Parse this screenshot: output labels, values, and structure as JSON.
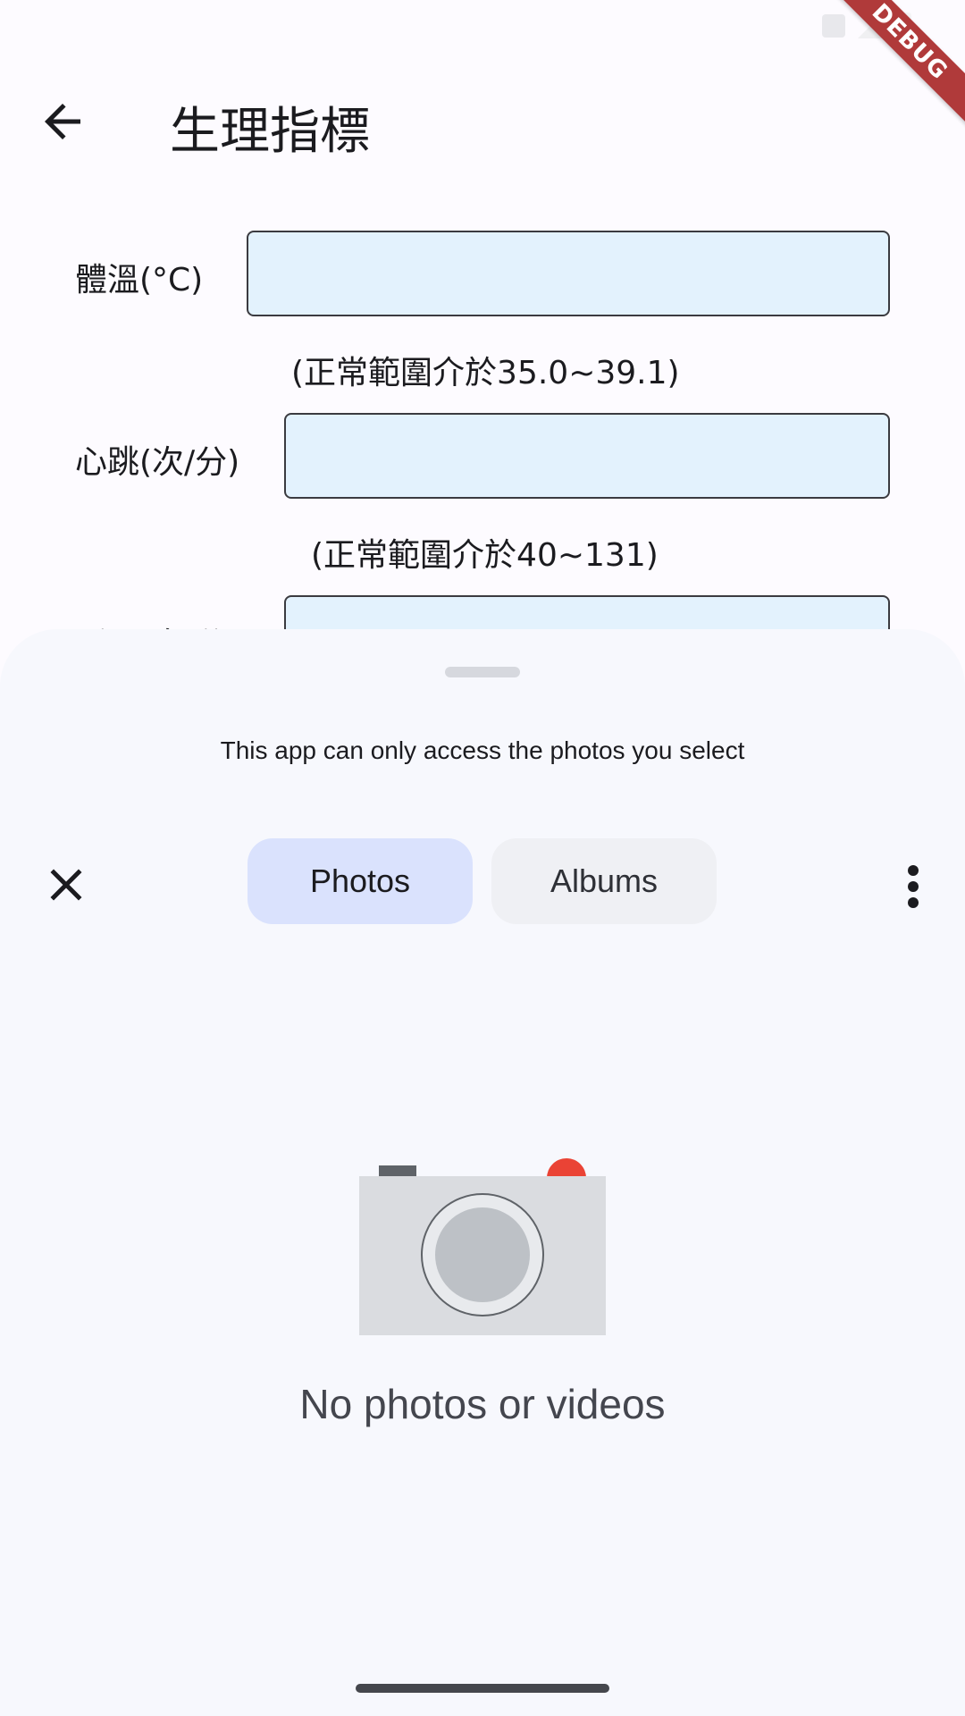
{
  "app": {
    "title": "生理指標",
    "debug_banner": "DEBUG"
  },
  "form": {
    "fields": [
      {
        "label": "體溫(°C)",
        "value": "",
        "hint": "(正常範圍介於35.0~39.1)"
      },
      {
        "label": "心跳(次/分)",
        "value": "",
        "hint": "(正常範圍介於40~131)"
      },
      {
        "label": "呼吸(次/分)",
        "value": ""
      }
    ]
  },
  "photo_picker": {
    "notice": "This app can only access the photos you select",
    "tabs": [
      {
        "label": "Photos",
        "selected": true
      },
      {
        "label": "Albums",
        "selected": false
      }
    ],
    "empty_state": "No photos or videos"
  },
  "icons": {
    "back": "arrow-back-icon",
    "close": "close-icon",
    "more": "more-vert-icon",
    "empty": "camera-icon"
  },
  "colors": {
    "input_fill": "#e3f2fd",
    "tab_selected": "#dae2fd",
    "tab_unselected": "#eff0f4",
    "sheet_bg": "#f7f8fd",
    "camera_record_dot": "#ea4335",
    "debug_banner": "#b03a3a"
  }
}
